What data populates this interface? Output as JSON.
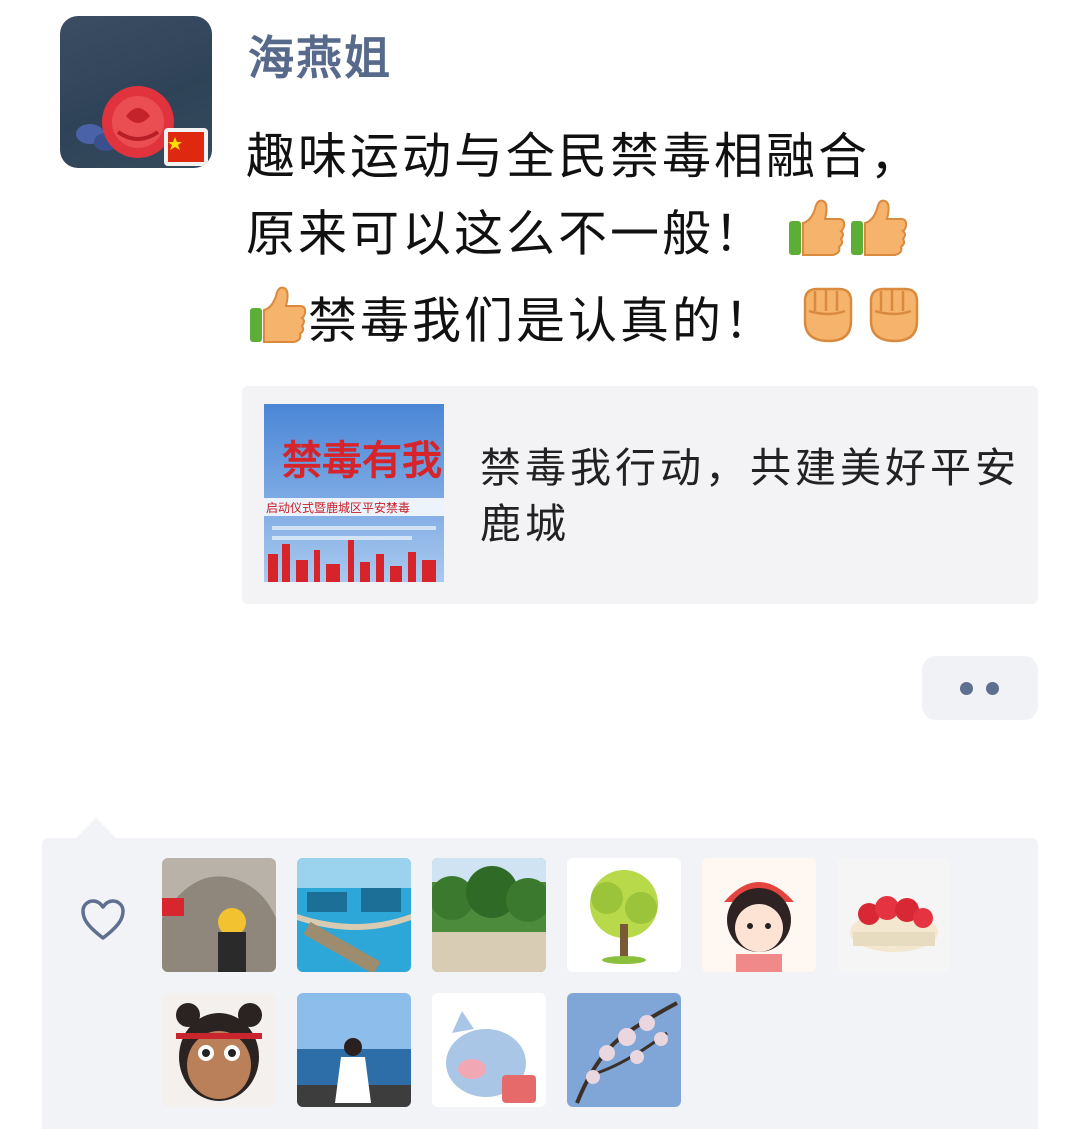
{
  "post": {
    "author": "海燕姐",
    "text_line1": "趣味运动与全民禁毒相融合，",
    "text_line2": "原来可以这么不一般！",
    "text_line3": "禁毒我们是认真的！",
    "emojis": [
      "thumbs-up-icon",
      "fist-icon"
    ]
  },
  "link_card": {
    "title": "禁毒我行动，共建美好平安鹿城",
    "thumb_banner": "禁毒有我",
    "thumb_subline": "启动仪式暨鹿城区平安禁毒"
  },
  "actions": {
    "more_icon": "more-dots-icon"
  },
  "likes": {
    "icon": "heart-icon",
    "likers": [
      "avatar-rock-hat",
      "avatar-pool-bridge",
      "avatar-forest",
      "avatar-green-tree",
      "avatar-cartoon-girl",
      "avatar-strawberry-cake",
      "avatar-cartoon-kid",
      "avatar-sea-girl",
      "avatar-cartoon-pig",
      "avatar-blossom-tree"
    ]
  },
  "colors": {
    "author_name": "#586a8c",
    "panel_bg": "#f2f3f6",
    "link_bg": "#f3f3f6"
  }
}
